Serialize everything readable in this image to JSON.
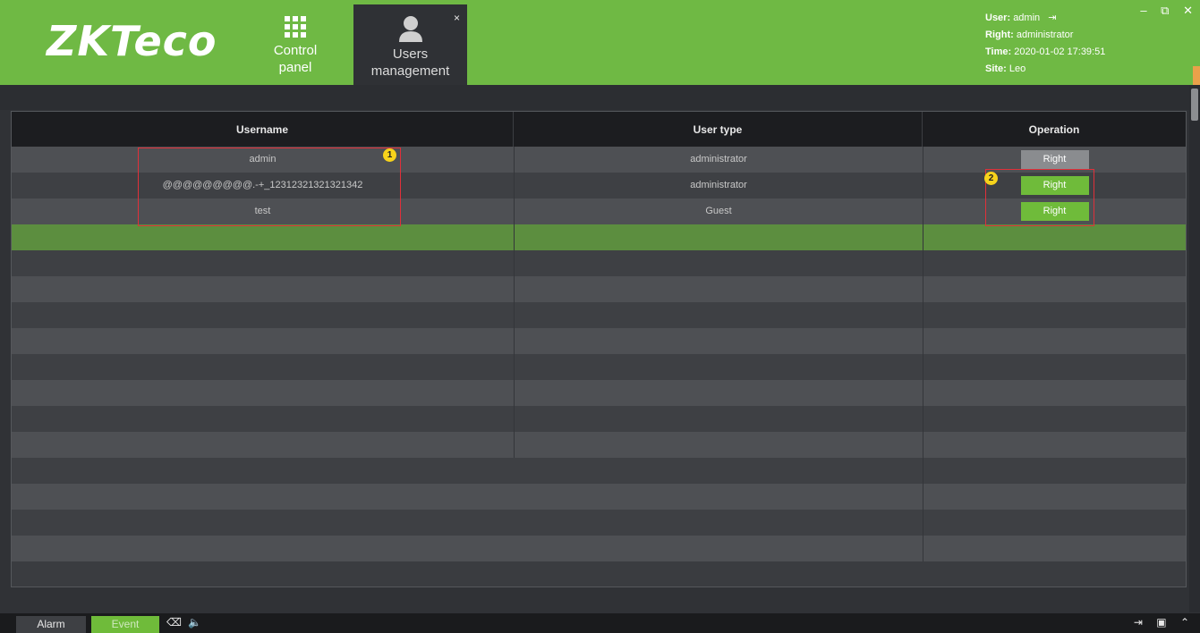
{
  "header": {
    "logo_text": "ZKTeco",
    "tabs": [
      {
        "label": "Control panel",
        "icon": "grid-icon"
      },
      {
        "label": "Users management",
        "icon": "user-icon",
        "close": "×"
      }
    ],
    "user_info": {
      "user_label": "User:",
      "user_value": "admin",
      "right_label": "Right:",
      "right_value": "administrator",
      "time_label": "Time:",
      "time_value": "2020-01-02 17:39:51",
      "site_label": "Site:",
      "site_value": "Leo"
    },
    "window_controls": [
      "–",
      "⧉",
      "✕"
    ]
  },
  "table": {
    "columns": [
      "Username",
      "User type",
      "Operation"
    ],
    "rows": [
      {
        "username": "admin",
        "user_type": "administrator",
        "operation": "Right",
        "button_state": "disabled"
      },
      {
        "username": "@@@@@@@@@.-+_12312321321321342",
        "user_type": "administrator",
        "operation": "Right",
        "button_state": "enabled"
      },
      {
        "username": "test",
        "user_type": "Guest",
        "operation": "Right",
        "button_state": "enabled"
      }
    ]
  },
  "annotations": {
    "badge1": "1",
    "badge2": "2"
  },
  "bottom": {
    "alarm_label": "Alarm",
    "event_label": "Event",
    "icons_left": [
      "broom-icon",
      "speaker-icon"
    ],
    "icons_right": [
      "pin-icon",
      "window-icon",
      "chevron-up-icon"
    ]
  },
  "colors": {
    "brand_green": "#6fb944",
    "annotation_red": "#e0303a",
    "badge_yellow": "#f7d31b"
  }
}
